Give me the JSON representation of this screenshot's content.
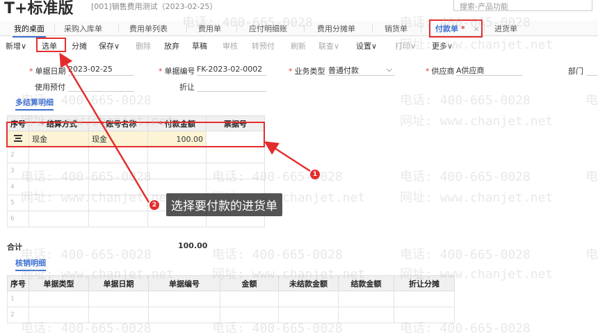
{
  "header": {
    "logo": "T+标准版",
    "account": "[001]销售费用测试（2023-02-25）",
    "search_placeholder": "搜索-产品功能"
  },
  "tabs": [
    {
      "label": "我的桌面"
    },
    {
      "label": "采购入库单"
    },
    {
      "label": "费用单列表"
    },
    {
      "label": "费用单"
    },
    {
      "label": "应付明细账"
    },
    {
      "label": "费用分摊单"
    },
    {
      "label": "销货单"
    },
    {
      "label": "付款单",
      "star": "*",
      "close": "×"
    },
    {
      "label": "进货单"
    }
  ],
  "toolbar": {
    "new": "新增∨",
    "select": "选单",
    "allocate": "分摊",
    "save": "保存∨",
    "delete": "删除",
    "discard": "放弃",
    "draft": "草稿",
    "audit": "审核",
    "prepay": "转预付",
    "refresh": "刷新",
    "link": "联查∨",
    "settings": "设置∨",
    "print": "打印∨",
    "more": "更多∨"
  },
  "form": {
    "date_label": "单据日期",
    "date_value": "2023-02-25",
    "number_label": "单据编号",
    "number_value": "FK-2023-02-0002",
    "biztype_label": "业务类型",
    "biztype_value": "普通付款",
    "supplier_label": "供应商",
    "supplier_value": "A供应商",
    "dept_label": "部门",
    "prepay_label": "使用预付",
    "discount_label": "折让"
  },
  "settlement": {
    "section_title": "多结算明细",
    "columns": [
      "序号",
      "结算方式",
      "账号名称",
      "付款金额",
      "票据号"
    ],
    "rows": [
      {
        "no": "",
        "method": "现金",
        "account": "现金",
        "amount": "100.00",
        "ticket": ""
      },
      {
        "no": "2",
        "method": "",
        "account": "",
        "amount": "",
        "ticket": ""
      },
      {
        "no": "3",
        "method": "",
        "account": "",
        "amount": "",
        "ticket": ""
      },
      {
        "no": "4",
        "method": "",
        "account": "",
        "amount": "",
        "ticket": ""
      },
      {
        "no": "5",
        "method": "",
        "account": "",
        "amount": "",
        "ticket": ""
      },
      {
        "no": "6",
        "method": "",
        "account": "",
        "amount": "",
        "ticket": ""
      }
    ],
    "total_label": "合计",
    "total_value": "100.00"
  },
  "writeoff": {
    "section_title": "核销明细",
    "columns": [
      "序号",
      "单据类型",
      "单据日期",
      "单据编号",
      "金额",
      "未结款金额",
      "结款金额",
      "折让分摊"
    ],
    "rows": [
      {
        "no": "1"
      },
      {
        "no": "2"
      }
    ]
  },
  "annotations": {
    "badge1": "1",
    "badge2": "2",
    "tip": "选择要付款的进货单"
  },
  "watermarks": {
    "phone": "电话: 400-665-0028",
    "site": "网址: www.chanjet.net",
    "phone_cut": "电"
  },
  "colors": {
    "accent": "#3d6fd1",
    "highlight": "#e32d2d",
    "selected_row": "#fcf4d4"
  }
}
